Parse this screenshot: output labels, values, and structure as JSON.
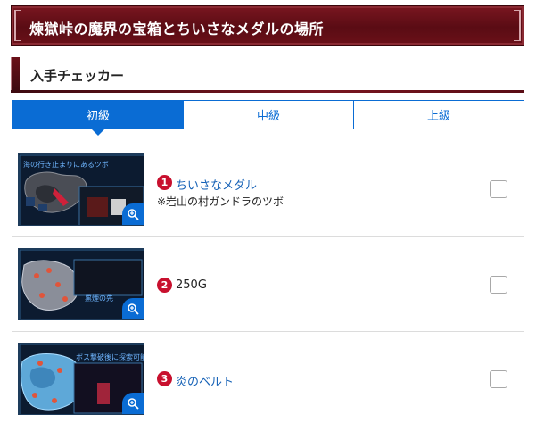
{
  "page": {
    "title": "煉獄峠の魔界の宝箱とちいさなメダルの場所"
  },
  "section": {
    "title": "入手チェッカー"
  },
  "tabs": [
    {
      "label": "初級",
      "active": true
    },
    {
      "label": "中級",
      "active": false
    },
    {
      "label": "上級",
      "active": false
    }
  ],
  "items": [
    {
      "number": "1",
      "name": "ちいさなメダル",
      "is_link": true,
      "note": "※岩山の村ガンドラのツボ",
      "map_caption": "海の行き止まりにあるツボ",
      "checked": false
    },
    {
      "number": "2",
      "name": "250G",
      "is_link": false,
      "note": "",
      "map_caption": "黒煙の先",
      "checked": false
    },
    {
      "number": "3",
      "name": "炎のベルト",
      "is_link": true,
      "note": "",
      "map_caption": "ボス撃破後に探索可能",
      "checked": false
    }
  ],
  "colors": {
    "header_red": "#6a1018",
    "tab_blue": "#0a6cd4",
    "badge_red": "#c8102e",
    "link_blue": "#1561b6"
  },
  "icons": {
    "zoom": "zoom-in-icon"
  }
}
